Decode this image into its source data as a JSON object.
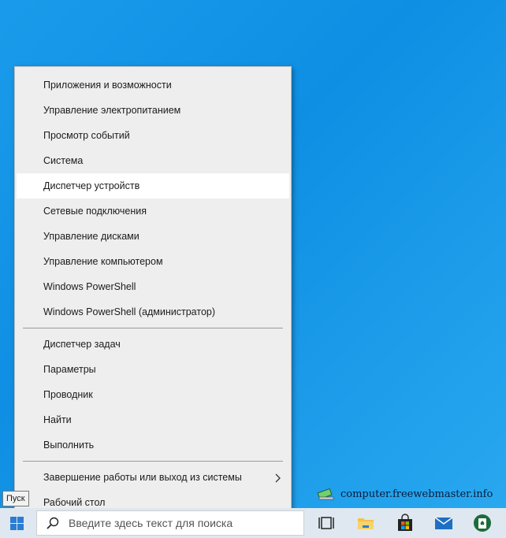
{
  "menu": {
    "group1": [
      {
        "label": "Приложения и возможности"
      },
      {
        "label": "Управление электропитанием"
      },
      {
        "label": "Просмотр событий"
      },
      {
        "label": "Система"
      },
      {
        "label": "Диспетчер устройств"
      },
      {
        "label": "Сетевые подключения"
      },
      {
        "label": "Управление дисками"
      },
      {
        "label": "Управление компьютером"
      },
      {
        "label": "Windows PowerShell"
      },
      {
        "label": "Windows PowerShell (администратор)"
      }
    ],
    "group2": [
      {
        "label": "Диспетчер задач"
      },
      {
        "label": "Параметры"
      },
      {
        "label": "Проводник"
      },
      {
        "label": "Найти"
      },
      {
        "label": "Выполнить"
      }
    ],
    "group3": [
      {
        "label": "Завершение работы или выход из системы"
      },
      {
        "label": "Рабочий стол"
      }
    ],
    "hovered_item": "Диспетчер устройств"
  },
  "taskbar": {
    "search_placeholder": "Введите здесь текст для поиска",
    "start_tooltip": "Пуск",
    "icons": [
      "task-view-icon",
      "file-explorer-icon",
      "microsoft-store-icon",
      "mail-icon",
      "solitaire-icon"
    ]
  },
  "watermark": {
    "text": "computer.freewebmaster.info"
  },
  "colors": {
    "desktop": "#1a9bea",
    "menu_bg": "#eeeeee",
    "menu_hover": "#ffffff",
    "taskbar": "#dfe8f0",
    "accent": "#2b7cd3"
  }
}
